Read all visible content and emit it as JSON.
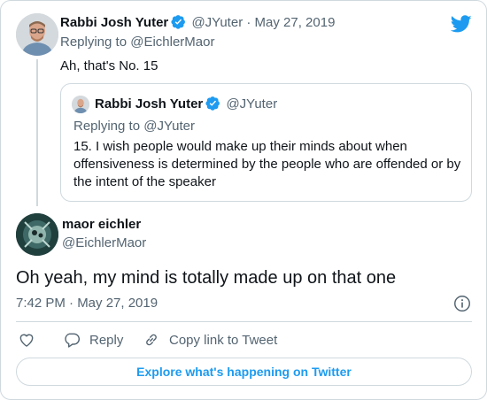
{
  "brand": {
    "accent": "#1d9bf0",
    "border": "#cfd9de",
    "muted": "#536471",
    "text": "#0f1419",
    "icon": "twitter-bird-icon"
  },
  "parent_tweet": {
    "name": "Rabbi Josh Yuter",
    "handle_date": "@JYuter · May 27, 2019",
    "replying_to": "Replying to @EichlerMaor",
    "text": "Ah, that's No. 15"
  },
  "quoted_tweet": {
    "name": "Rabbi Josh Yuter",
    "handle": "@JYuter",
    "replying_to": "Replying to @JYuter",
    "text": "15. I wish people would make up their minds about when offensiveness is determined by the people who are offended or by the intent of the speaker"
  },
  "main_tweet": {
    "name": "maor eichler",
    "handle": "@EichlerMaor",
    "text": "Oh yeah, my mind is totally made up on that one",
    "timestamp": "7:42 PM · May 27, 2019"
  },
  "actions": {
    "like_icon": "heart-icon",
    "reply_label": "Reply",
    "copy_label": "Copy link to Tweet"
  },
  "explore_label": "Explore what's happening on Twitter"
}
